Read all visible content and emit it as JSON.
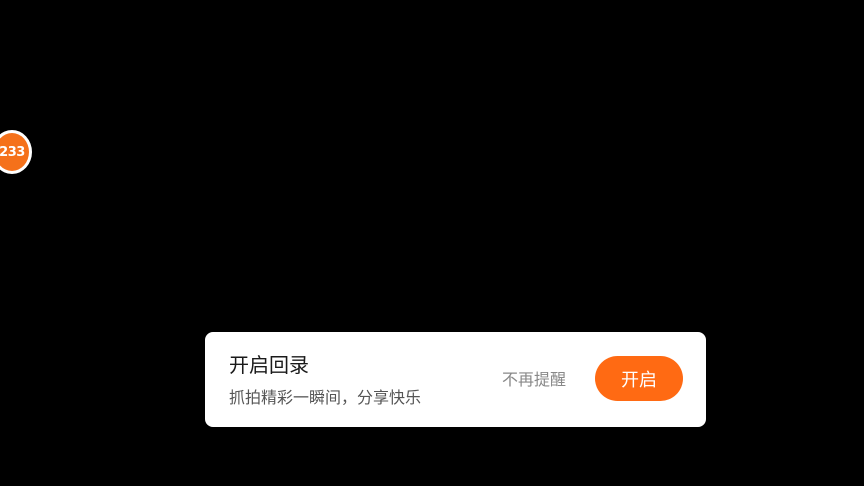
{
  "floating_badge": {
    "label": "233",
    "color": "#f5711a"
  },
  "replay_prompt": {
    "title": "开启回录",
    "subtitle": "抓拍精彩一瞬间，分享快乐",
    "dismiss_label": "不再提醒",
    "enable_label": "开启",
    "accent_color": "#ff6a13"
  }
}
